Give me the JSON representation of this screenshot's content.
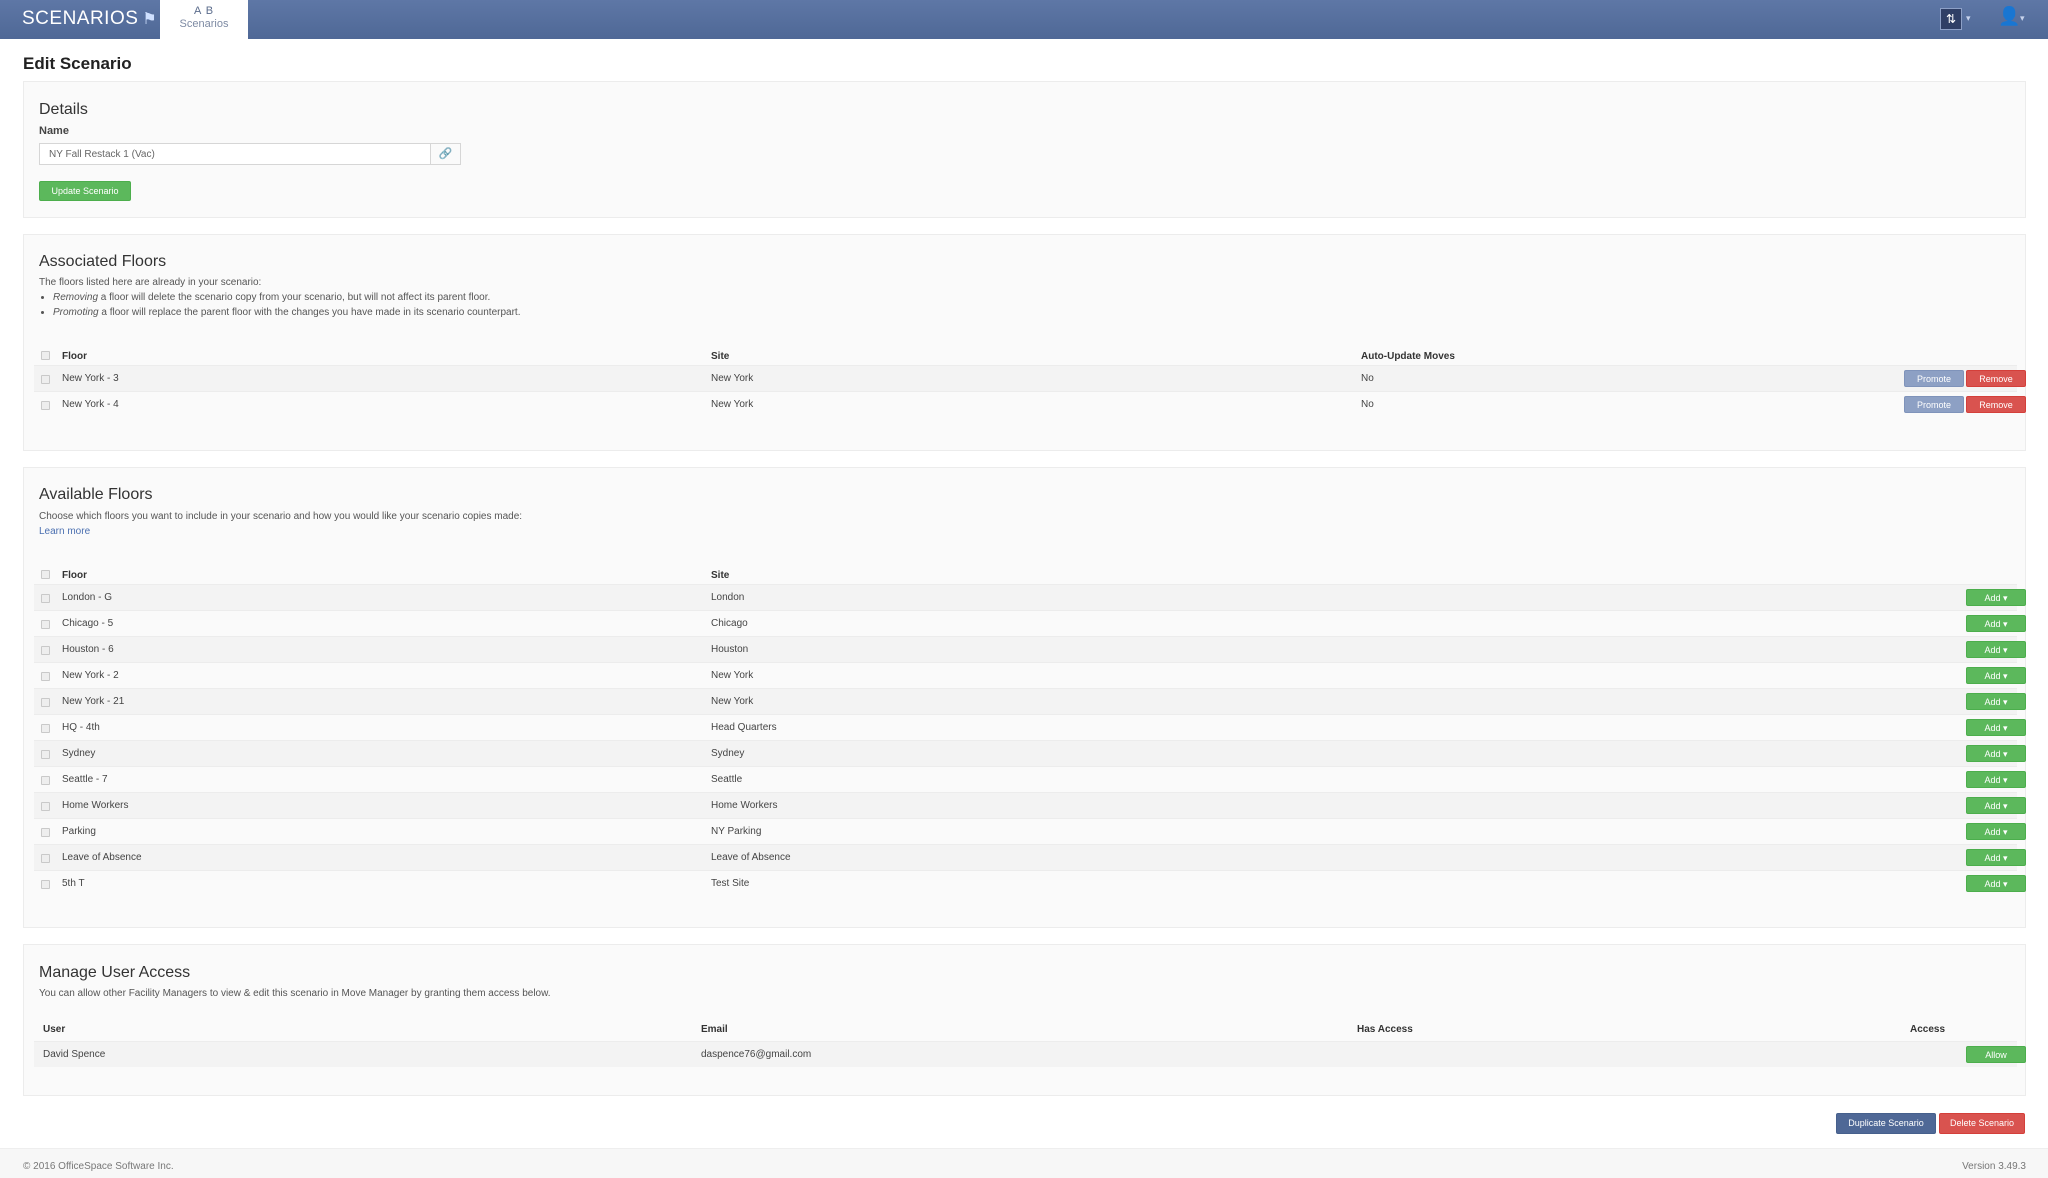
{
  "brand": {
    "name": "SCENARIOS"
  },
  "nav": {
    "tab_icon": "A B",
    "tab_label": "Scenarios"
  },
  "page": {
    "title": "Edit Scenario"
  },
  "details": {
    "heading": "Details",
    "name_label": "Name",
    "name_value": "NY Fall Restack 1 (Vac)",
    "update_button": "Update Scenario"
  },
  "associated": {
    "heading": "Associated Floors",
    "intro": "The floors listed here are already in your scenario:",
    "bullet1_em": "Removing",
    "bullet1_rest": " a floor will delete the scenario copy from your scenario, but will not affect its parent floor.",
    "bullet2_em": "Promoting",
    "bullet2_rest": " a floor will replace the parent floor with the changes you have made in its scenario counterpart.",
    "columns": {
      "floor": "Floor",
      "site": "Site",
      "auto": "Auto-Update Moves"
    },
    "rows": [
      {
        "floor": "New York - 3",
        "site": "New York",
        "auto": "No"
      },
      {
        "floor": "New York - 4",
        "site": "New York",
        "auto": "No"
      }
    ],
    "promote_label": "Promote",
    "remove_label": "Remove"
  },
  "available": {
    "heading": "Available Floors",
    "intro": "Choose which floors you want to include in your scenario and how you would like your scenario copies made:",
    "learn_more": "Learn more",
    "columns": {
      "floor": "Floor",
      "site": "Site"
    },
    "rows": [
      {
        "floor": "London - G",
        "site": "London"
      },
      {
        "floor": "Chicago - 5",
        "site": "Chicago"
      },
      {
        "floor": "Houston - 6",
        "site": "Houston"
      },
      {
        "floor": "New York - 2",
        "site": "New York"
      },
      {
        "floor": "New York - 21",
        "site": "New York"
      },
      {
        "floor": "HQ - 4th",
        "site": "Head Quarters"
      },
      {
        "floor": "Sydney",
        "site": "Sydney"
      },
      {
        "floor": "Seattle - 7",
        "site": "Seattle"
      },
      {
        "floor": "Home Workers",
        "site": "Home Workers"
      },
      {
        "floor": "Parking",
        "site": "NY Parking"
      },
      {
        "floor": "Leave of Absence",
        "site": "Leave of Absence"
      },
      {
        "floor": "5th T",
        "site": "Test Site"
      }
    ],
    "add_label": "Add ▾"
  },
  "access": {
    "heading": "Manage User Access",
    "intro": "You can allow other Facility Managers to view & edit this scenario in Move Manager by granting them access below.",
    "columns": {
      "user": "User",
      "email": "Email",
      "has_access": "Has Access",
      "access": "Access"
    },
    "rows": [
      {
        "user": "David Spence",
        "email": "daspence76@gmail.com",
        "has_access": "",
        "action": "Allow"
      }
    ]
  },
  "actions": {
    "duplicate": "Duplicate Scenario",
    "delete": "Delete Scenario"
  },
  "footer": {
    "copyright": "© 2016 OfficeSpace Software Inc.",
    "version": "Version 3.49.3"
  }
}
